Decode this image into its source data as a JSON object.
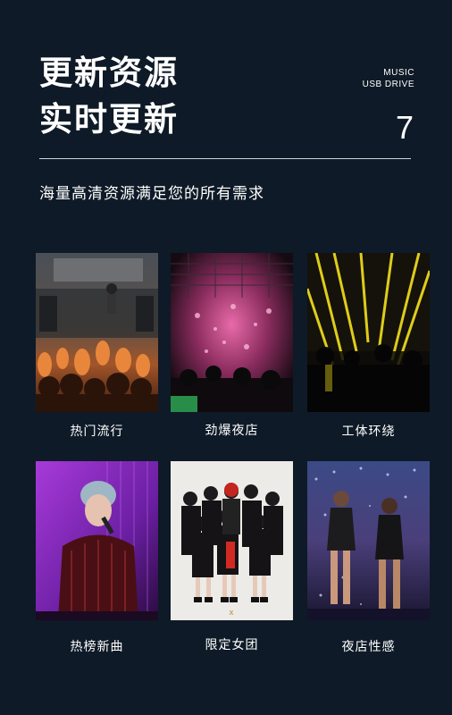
{
  "header": {
    "title_line1": "更新资源",
    "title_line2": "实时更新",
    "tag_line1": "MUSIC",
    "tag_line2": "USB DRIVE",
    "number": "7"
  },
  "subtitle": "海量高清资源满足您的所有需求",
  "categories": [
    {
      "label": "热门流行",
      "image": "concert-crowd-photo"
    },
    {
      "label": "劲爆夜店",
      "image": "nightclub-pink-lights-photo"
    },
    {
      "label": "工体环绕",
      "image": "club-yellow-lasers-photo"
    },
    {
      "label": "热榜新曲",
      "image": "singer-with-microphone-photo"
    },
    {
      "label": "限定女团",
      "image": "girl-group-photo"
    },
    {
      "label": "夜店性感",
      "image": "club-dancers-photo"
    }
  ]
}
